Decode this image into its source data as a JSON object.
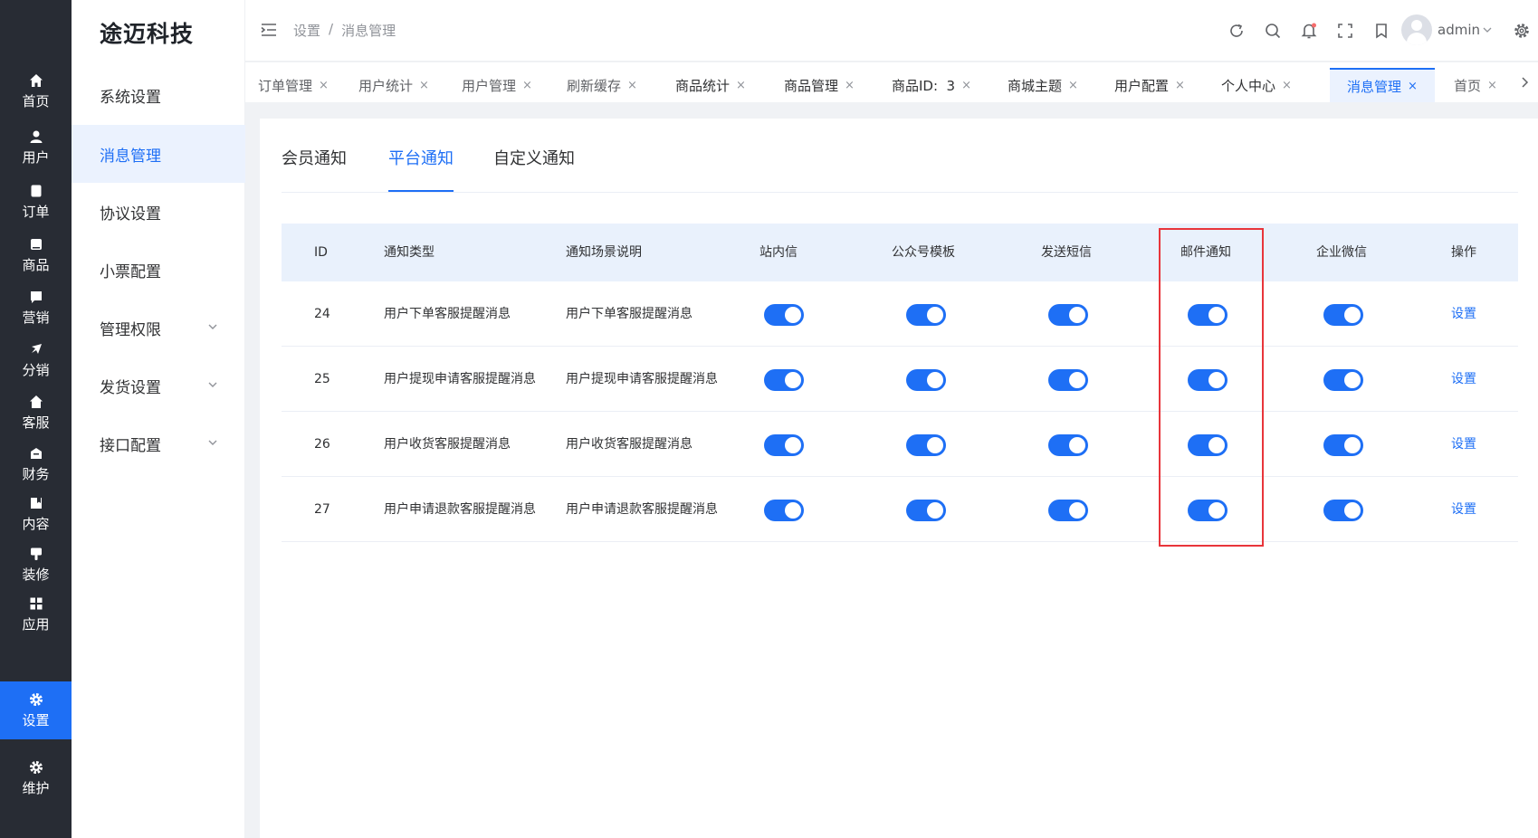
{
  "rail": {
    "items": [
      {
        "label": "首页",
        "icon": "home-icon"
      },
      {
        "label": "用户",
        "icon": "user-icon"
      },
      {
        "label": "订单",
        "icon": "order-icon"
      },
      {
        "label": "商品",
        "icon": "product-icon"
      },
      {
        "label": "营销",
        "icon": "marketing-icon"
      },
      {
        "label": "分销",
        "icon": "distribution-icon"
      },
      {
        "label": "客服",
        "icon": "service-icon"
      },
      {
        "label": "财务",
        "icon": "finance-icon"
      },
      {
        "label": "内容",
        "icon": "content-icon"
      },
      {
        "label": "装修",
        "icon": "decoration-icon"
      },
      {
        "label": "应用",
        "icon": "apps-icon"
      },
      {
        "label": "设置",
        "icon": "gear-icon"
      },
      {
        "label": "维护",
        "icon": "gear-icon"
      }
    ],
    "active_index": 11,
    "active_color": "#1e6ff5"
  },
  "submenu": {
    "brand": "途迈科技",
    "items": [
      {
        "label": "系统设置"
      },
      {
        "label": "消息管理"
      },
      {
        "label": "协议设置"
      },
      {
        "label": "小票配置"
      },
      {
        "label": "管理权限"
      },
      {
        "label": "发货设置"
      },
      {
        "label": "接口配置"
      }
    ],
    "active_index": 1
  },
  "header": {
    "breadcrumb": [
      "设置",
      "/",
      "消息管理"
    ],
    "user_name": "admin",
    "icons": [
      "refresh-icon",
      "search-icon",
      "bell-icon",
      "fullscreen-icon",
      "bookmark-icon",
      "settings-icon"
    ]
  },
  "tabs": {
    "items": [
      {
        "label": "订单管理"
      },
      {
        "label": "用户统计"
      },
      {
        "label": "用户管理"
      },
      {
        "label": "刷新缓存"
      },
      {
        "label": "商品统计"
      },
      {
        "label": "商品管理"
      },
      {
        "label": "商品ID:  3"
      },
      {
        "label": "商城主题"
      },
      {
        "label": "用户配置"
      },
      {
        "label": "个人中心"
      },
      {
        "label": "消息管理"
      },
      {
        "label": "首页"
      }
    ],
    "active_index": 10,
    "close_symbol": "×"
  },
  "notify_tabs": {
    "items": [
      "会员通知",
      "平台通知",
      "自定义通知"
    ],
    "active_index": 1
  },
  "table": {
    "columns": [
      "ID",
      "通知类型",
      "通知场景说明",
      "站内信",
      "公众号模板",
      "发送短信",
      "邮件通知",
      "企业微信",
      "操作"
    ],
    "rows": [
      {
        "id": "24",
        "type": "用户下单客服提醒消息",
        "desc": "用户下单客服提醒消息",
        "action": "设置"
      },
      {
        "id": "25",
        "type": "用户提现申请客服提醒消息",
        "desc": "用户提现申请客服提醒消息",
        "action": "设置"
      },
      {
        "id": "26",
        "type": "用户收货客服提醒消息",
        "desc": "用户收货客服提醒消息",
        "action": "设置"
      },
      {
        "id": "27",
        "type": "用户申请退款客服提醒消息",
        "desc": "用户申请退款客服提醒消息",
        "action": "设置"
      }
    ],
    "switches_on": true,
    "highlighted_column": "邮件通知",
    "highlight_color": "#e8353b"
  }
}
